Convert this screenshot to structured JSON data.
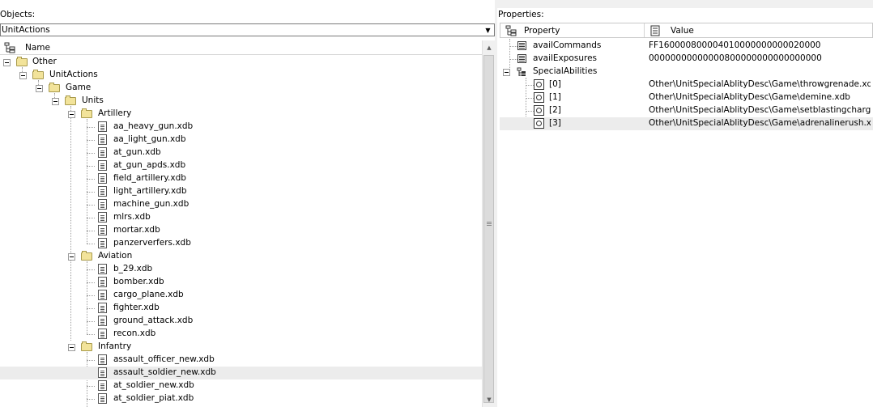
{
  "objects_label": "Objects:",
  "properties_label": "Properties:",
  "combo": {
    "value": "UnitActions"
  },
  "tree": {
    "header": "Name",
    "nodes": {
      "other": "Other",
      "unitactions": "UnitActions",
      "game": "Game",
      "units": "Units",
      "artillery": "Artillery",
      "aviation": "Aviation",
      "infantry": "Infantry"
    },
    "artillery_files": [
      "aa_heavy_gun.xdb",
      "aa_light_gun.xdb",
      "at_gun.xdb",
      "at_gun_apds.xdb",
      "field_artillery.xdb",
      "light_artillery.xdb",
      "machine_gun.xdb",
      "mlrs.xdb",
      "mortar.xdb",
      "panzerverfers.xdb"
    ],
    "aviation_files": [
      "b_29.xdb",
      "bomber.xdb",
      "cargo_plane.xdb",
      "fighter.xdb",
      "ground_attack.xdb",
      "recon.xdb"
    ],
    "infantry_files": [
      "assault_officer_new.xdb",
      "assault_soldier_new.xdb",
      "at_soldier_new.xdb",
      "at_soldier_piat.xdb"
    ],
    "selected_file": "assault_soldier_new.xdb"
  },
  "properties": {
    "col_property": "Property",
    "col_value": "Value",
    "rows": [
      {
        "name": "availCommands",
        "value": "FF160000800004010000000000020000"
      },
      {
        "name": "availExposures",
        "value": "00000000000000800000000000000000"
      },
      {
        "name": "SpecialAbilities",
        "value": ""
      },
      {
        "name": "[0]",
        "value": "Other\\UnitSpecialAblityDesc\\Game\\throwgrenade.xdb"
      },
      {
        "name": "[1]",
        "value": "Other\\UnitSpecialAblityDesc\\Game\\demine.xdb"
      },
      {
        "name": "[2]",
        "value": "Other\\UnitSpecialAblityDesc\\Game\\setblastingcharge...."
      },
      {
        "name": "[3]",
        "value": "Other\\UnitSpecialAblityDesc\\Game\\adrenalinerush.xdb"
      }
    ]
  }
}
